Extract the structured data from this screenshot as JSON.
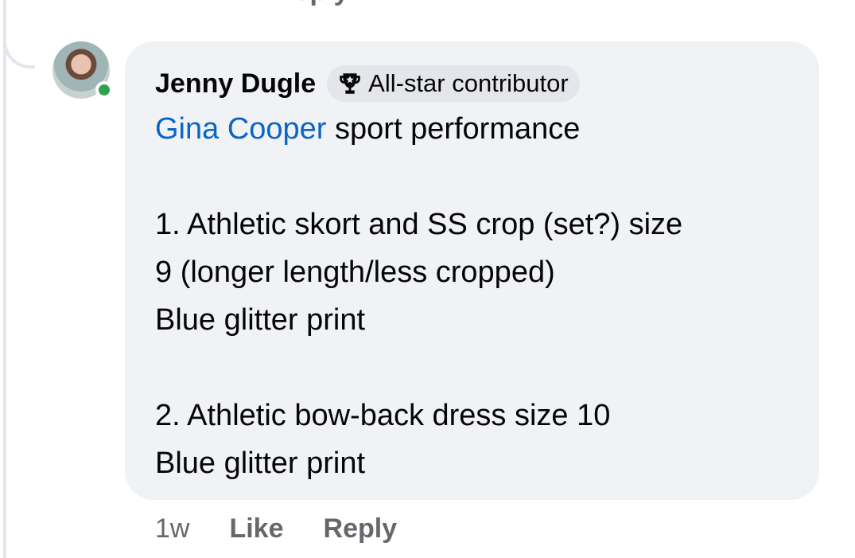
{
  "previous_comment": {
    "reply_label": "Reply"
  },
  "comment": {
    "author": "Jenny Dugle",
    "badge": {
      "icon": "trophy-icon",
      "label": "All-star contributor"
    },
    "mention": "Gina Cooper",
    "first_line_rest": " sport performance",
    "lines": [
      "1. Athletic skort and SS crop (set?) size",
      "9 (longer length/less cropped)",
      "Blue glitter print",
      "",
      "2. Athletic bow-back dress size 10",
      "Blue glitter print"
    ],
    "online": true
  },
  "actions": {
    "time": "1w",
    "like": "Like",
    "reply": "Reply"
  },
  "colors": {
    "bubble": "#f0f2f5",
    "mention": "#0a66c2",
    "online": "#31a24c",
    "muted": "#65676b"
  }
}
